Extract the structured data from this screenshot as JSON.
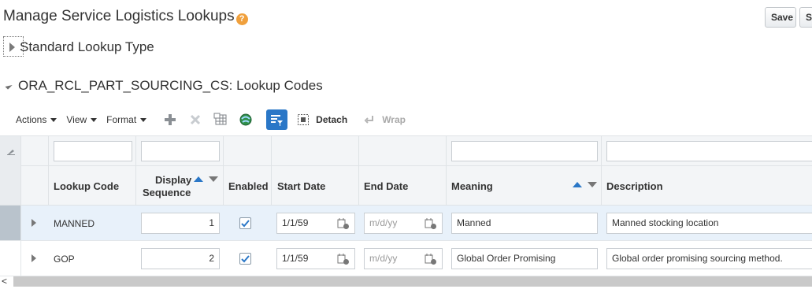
{
  "page": {
    "title": "Manage Service Logistics Lookups",
    "help_glyph": "?",
    "save_label": "Save",
    "save_close_label": "Save and Close"
  },
  "standard_section": {
    "label": "Standard Lookup Type"
  },
  "codes_section": {
    "label": "ORA_RCL_PART_SOURCING_CS: Lookup Codes"
  },
  "toolbar": {
    "actions_label": "Actions",
    "view_label": "View",
    "format_label": "Format",
    "detach_label": "Detach",
    "wrap_label": "Wrap"
  },
  "columns": {
    "lookup_code": "Lookup Code",
    "display_sequence_1": "Display",
    "display_sequence_2": "Sequence",
    "enabled": "Enabled",
    "start_date": "Start Date",
    "end_date": "End Date",
    "meaning": "Meaning",
    "description": "Description"
  },
  "date_placeholder": "m/d/yy",
  "rows": [
    {
      "lookup_code": "MANNED",
      "display_sequence": "1",
      "enabled": true,
      "start_date": "1/1/59",
      "end_date": "",
      "meaning": "Manned",
      "description": "Manned stocking location",
      "selected": true
    },
    {
      "lookup_code": "GOP",
      "display_sequence": "2",
      "enabled": true,
      "start_date": "1/1/59",
      "end_date": "",
      "meaning": "Global Order Promising",
      "description": "Global order promising sourcing method.",
      "selected": false
    }
  ],
  "colors": {
    "accent": "#2a77c7",
    "help": "#f0a03c",
    "selected_row": "#e8f1fa"
  }
}
